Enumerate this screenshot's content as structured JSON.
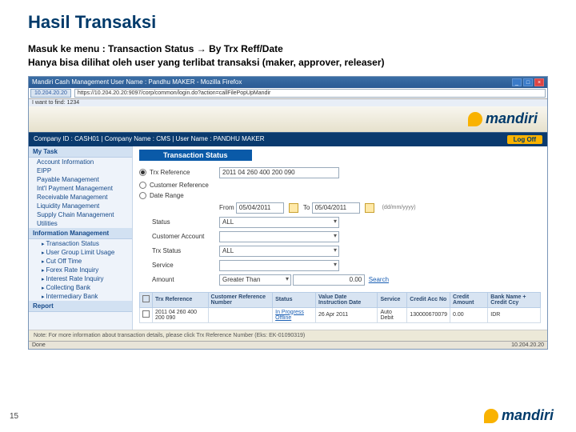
{
  "slide": {
    "title": "Hasil Transaksi",
    "subtitle_1": "Masuk ke menu : Transaction Status",
    "subtitle_arrow": "→",
    "subtitle_2": "By Trx Reff/Date",
    "subtitle_3": "Hanya bisa dilihat oleh user yang terlibat transaksi (maker, approver, releaser)",
    "page_number": "15",
    "footer_brand": "mandiri"
  },
  "browser": {
    "title": "Mandiri Cash Management User Name : Pandhu MAKER - Mozilla Firefox",
    "addr_label": "10.204.20.20",
    "url": "https://10.204.20.20:9097/corp/common/login.do?action=callFilePopUpMandir",
    "menu": "I want to find:  1234"
  },
  "banner": {
    "brand": "mandiri"
  },
  "infobar": {
    "left": "Company ID : CASH01   |   Company Name : CMS   |   User Name : PANDHU MAKER",
    "logoff": "Log Off"
  },
  "sidebar": {
    "groups": [
      "My Task"
    ],
    "items_a": [
      "Account Information",
      "EIPP",
      "Payable Management",
      "Int'l Payment Management",
      "Receivable Management",
      "Liquidity Management",
      "Supply Chain Management",
      "Utilities"
    ],
    "group_b": "Information Management",
    "subs": [
      "Transaction Status",
      "User Group Limit Usage",
      "Cut Off Time",
      "Forex Rate Inquiry",
      "Interest Rate Inquiry",
      "Collecting Bank",
      "Intermediary Bank"
    ],
    "group_c": "Report"
  },
  "form": {
    "section": "Transaction Status",
    "trx_ref_label": "Trx Reference",
    "trx_ref_value": "2011 04 260 400 200 090",
    "cust_ref_label": "Customer Reference",
    "date_range_label": "Date Range",
    "from_prefix": "From",
    "from_date": "05/04/2011",
    "to_prefix": "To",
    "to_date": "05/04/2011",
    "date_format": "(dd/mm/yyyy)",
    "status_label": "Status",
    "status_value": "ALL",
    "cust_acc_label": "Customer Account",
    "trx_status_label": "Trx Status",
    "trx_status_value": "ALL",
    "service_label": "Service",
    "amount_label": "Amount",
    "amount_op": "Greater Than",
    "amount_val": "0.00",
    "search": "Search"
  },
  "table": {
    "headers": [
      "",
      "Trx Reference",
      "Customer Reference Number",
      "Status",
      "Value Date Instruction Date",
      "Service",
      "Credit Acc No",
      "Credit Amount",
      "Bank Name + Credit Ccy"
    ],
    "row": {
      "trx_ref": "2011 04 260 400 200 090",
      "cust_ref": "",
      "status": "In Progress Offline",
      "date": "26 Apr 2011",
      "service": "Auto Debit",
      "credit_acc": "130000670079",
      "credit_amt": "0.00",
      "bank": "IDR"
    }
  },
  "note": "Note: For more information about transaction details, please click Trx Reference Number (Eks: EK-01090319)",
  "statusbar": {
    "left": "Done",
    "right": "10.204.20.20"
  }
}
